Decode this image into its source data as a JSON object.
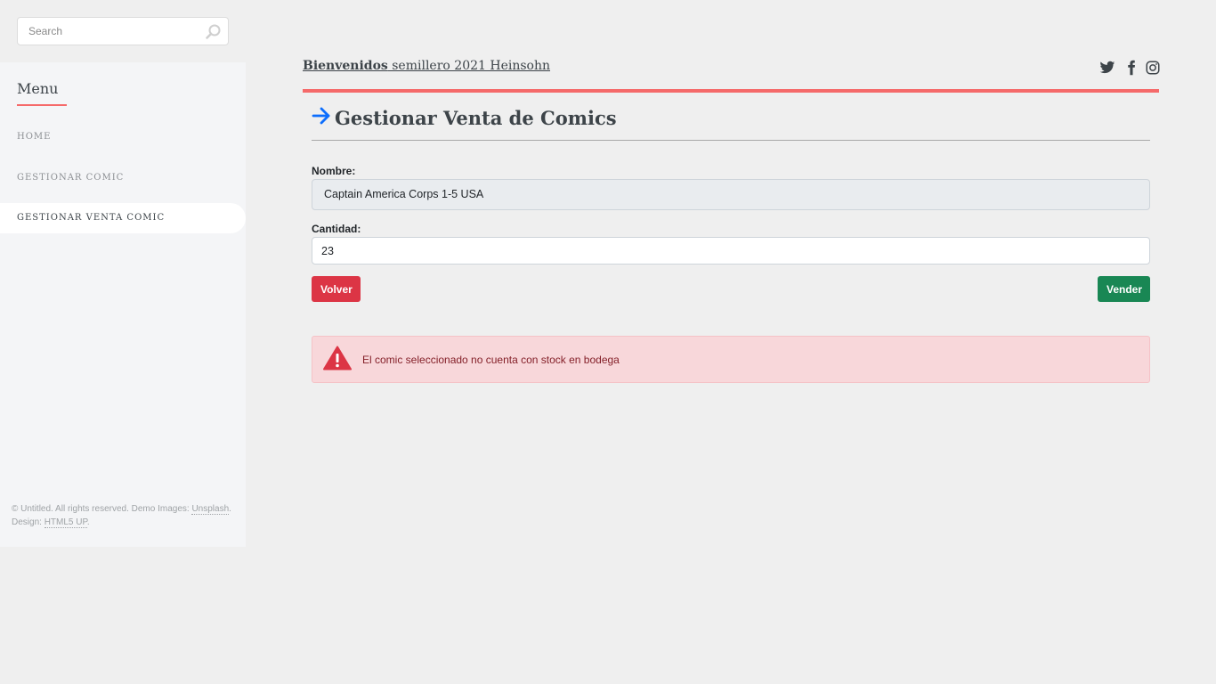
{
  "sidebar": {
    "search": {
      "placeholder": "Search"
    },
    "menu_title": "Menu",
    "items": [
      {
        "label": "HOME"
      },
      {
        "label": "GESTIONAR COMIC"
      },
      {
        "label": "GESTIONAR VENTA COMIC"
      }
    ],
    "footer": {
      "prefix": "© Untitled. All rights reserved. Demo Images: ",
      "link1": "Unsplash",
      "middle": ". Design: ",
      "link2": "HTML5 UP",
      "suffix": "."
    }
  },
  "header": {
    "welcome_bold": "Bienvenidos",
    "welcome_rest": " semillero 2021 Heinsohn",
    "social_icons": [
      "twitter-icon",
      "facebook-icon",
      "instagram-icon"
    ]
  },
  "main": {
    "title": "Gestionar Venta de Comics",
    "form": {
      "name_label": "Nombre:",
      "name_value": "Captain America Corps 1-5 USA",
      "qty_label": "Cantidad:",
      "qty_value": "23"
    },
    "buttons": {
      "back": "Volver",
      "sell": "Vender"
    },
    "alert": {
      "message": "El comic seleccionado no cuenta con stock en bodega"
    }
  },
  "colors": {
    "accent": "#f56a6a",
    "danger": "#dc3545",
    "success": "#198754",
    "title_arrow": "#0d6efd",
    "alert_bg": "#f8d7da"
  }
}
